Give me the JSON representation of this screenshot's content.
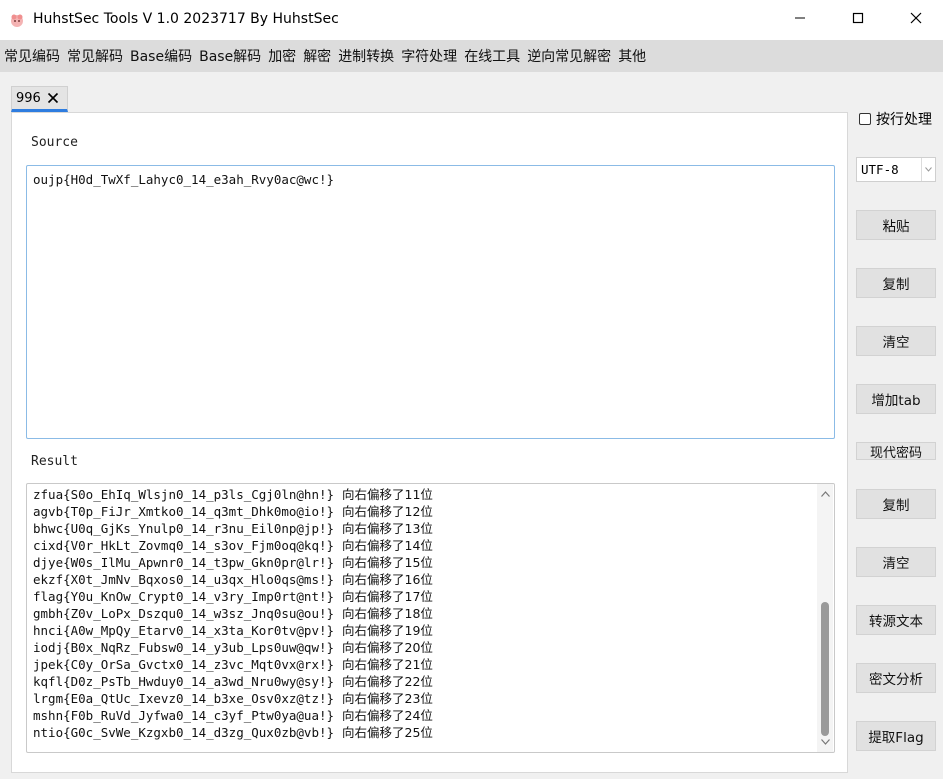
{
  "window": {
    "title": "HuhstSec Tools V 1.0 2023717 By HuhstSec"
  },
  "menu": [
    "常见编码",
    "常见解码",
    "Base编码",
    "Base解码",
    "加密",
    "解密",
    "进制转换",
    "字符处理",
    "在线工具",
    "逆向常见解密",
    "其他"
  ],
  "tab": {
    "label": "996"
  },
  "source": {
    "label": "Source",
    "value": "oujp{H0d_TwXf_Lahyc0_14_e3ah_Rvy0ac@wc!}"
  },
  "result": {
    "label": "Result",
    "lines": [
      {
        "code": "zfua{S0o_EhIq_Wlsjn0_14_p3ls_Cgj0ln@hn!}",
        "desc": "向右偏移了11位"
      },
      {
        "code": "agvb{T0p_FiJr_Xmtko0_14_q3mt_Dhk0mo@io!}",
        "desc": "向右偏移了12位"
      },
      {
        "code": "bhwc{U0q_GjKs_Ynulp0_14_r3nu_Eil0np@jp!}",
        "desc": "向右偏移了13位"
      },
      {
        "code": "cixd{V0r_HkLt_Zovmq0_14_s3ov_Fjm0oq@kq!}",
        "desc": "向右偏移了14位"
      },
      {
        "code": "djye{W0s_IlMu_Apwnr0_14_t3pw_Gkn0pr@lr!}",
        "desc": "向右偏移了15位"
      },
      {
        "code": "ekzf{X0t_JmNv_Bqxos0_14_u3qx_Hlo0qs@ms!}",
        "desc": "向右偏移了16位"
      },
      {
        "code": "flag{Y0u_KnOw_Crypt0_14_v3ry_Imp0rt@nt!}",
        "desc": "向右偏移了17位"
      },
      {
        "code": "gmbh{Z0v_LoPx_Dszqu0_14_w3sz_Jnq0su@ou!}",
        "desc": "向右偏移了18位"
      },
      {
        "code": "hnci{A0w_MpQy_Etarv0_14_x3ta_Kor0tv@pv!}",
        "desc": "向右偏移了19位"
      },
      {
        "code": "iodj{B0x_NqRz_Fubsw0_14_y3ub_Lps0uw@qw!}",
        "desc": "向右偏移了20位"
      },
      {
        "code": "jpek{C0y_OrSa_Gvctx0_14_z3vc_Mqt0vx@rx!}",
        "desc": "向右偏移了21位"
      },
      {
        "code": "kqfl{D0z_PsTb_Hwduy0_14_a3wd_Nru0wy@sy!}",
        "desc": "向右偏移了22位"
      },
      {
        "code": "lrgm{E0a_QtUc_Ixevz0_14_b3xe_Osv0xz@tz!}",
        "desc": "向右偏移了23位"
      },
      {
        "code": "mshn{F0b_RuVd_Jyfwa0_14_c3yf_Ptw0ya@ua!}",
        "desc": "向右偏移了24位"
      },
      {
        "code": "ntio{G0c_SvWe_Kzgxb0_14_d3zg_Qux0zb@vb!}",
        "desc": "向右偏移了25位"
      }
    ]
  },
  "options": {
    "line_mode_label": "按行处理",
    "encoding": "UTF-8"
  },
  "buttons": {
    "paste": "粘贴",
    "copy_source": "复制",
    "clear_source": "清空",
    "add_tab": "增加tab",
    "modern_crypto": "现代密码",
    "copy_result": "复制",
    "clear_result": "清空",
    "to_source": "转源文本",
    "cipher_analysis": "密文分析",
    "extract_flag": "提取Flag"
  },
  "colors": {
    "accent": "#2e7de0",
    "source_border": "#8bbbe6"
  }
}
